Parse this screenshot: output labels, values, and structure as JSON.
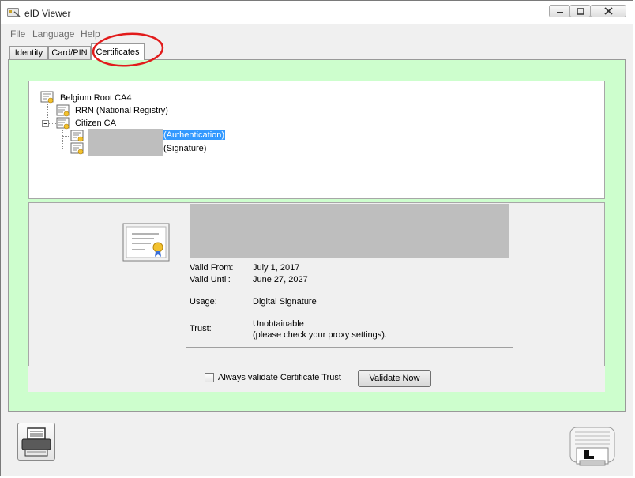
{
  "window": {
    "title": "eID Viewer"
  },
  "menu": {
    "file": "File",
    "language": "Language",
    "help": "Help"
  },
  "tabs": {
    "identity": "Identity",
    "card_pin": "Card/PIN",
    "certificates": "Certificates"
  },
  "tree": {
    "root": "Belgium Root CA4",
    "rrn": "RRN (National Registry)",
    "citizen_ca": "Citizen CA",
    "auth": "(Authentication)",
    "sign": "(Signature)"
  },
  "details": {
    "valid_from_label": "Valid From:",
    "valid_from": "July 1, 2017",
    "valid_until_label": "Valid Until:",
    "valid_until": "June 27, 2027",
    "usage_label": "Usage:",
    "usage": "Digital Signature",
    "trust_label": "Trust:",
    "trust_line1": "Unobtainable",
    "trust_line2": "(please check your proxy settings)."
  },
  "bottom": {
    "always_validate": "Always validate Certificate Trust",
    "validate_now": "Validate Now"
  },
  "colors": {
    "content_bg": "#cdfecd",
    "selection": "#3399ff",
    "annotation": "#e21b1b"
  }
}
